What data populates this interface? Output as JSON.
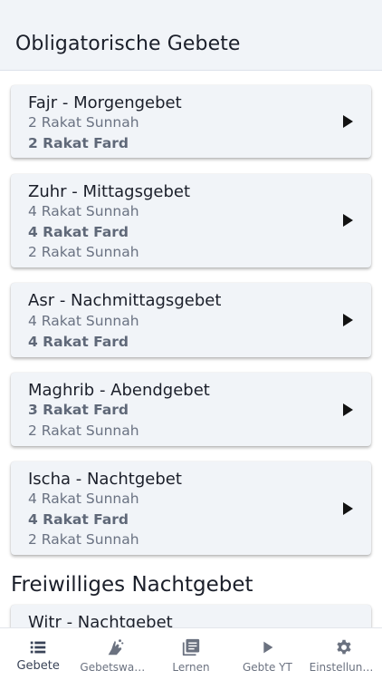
{
  "header": {
    "title": "Obligatorische Gebete"
  },
  "prayers": [
    {
      "name": "Fajr - Morgengebet",
      "lines": [
        {
          "text": "2 Rakat Sunnah",
          "bold": false
        },
        {
          "text": "2 Rakat Fard",
          "bold": true
        }
      ]
    },
    {
      "name": "Zuhr - Mittagsgebet",
      "lines": [
        {
          "text": "4 Rakat Sunnah",
          "bold": false
        },
        {
          "text": "4 Rakat Fard",
          "bold": true
        },
        {
          "text": "2 Rakat Sunnah",
          "bold": false
        }
      ]
    },
    {
      "name": "Asr - Nachmittagsgebet",
      "lines": [
        {
          "text": "4 Rakat Sunnah",
          "bold": false
        },
        {
          "text": "4 Rakat Fard",
          "bold": true
        }
      ]
    },
    {
      "name": "Maghrib - Abendgebet",
      "lines": [
        {
          "text": "3 Rakat Fard",
          "bold": true
        },
        {
          "text": "2 Rakat Sunnah",
          "bold": false
        }
      ]
    },
    {
      "name": "Ischa - Nachtgebet",
      "lines": [
        {
          "text": "4 Rakat Sunnah",
          "bold": false
        },
        {
          "text": "4 Rakat Fard",
          "bold": true
        },
        {
          "text": "2 Rakat Sunnah",
          "bold": false
        }
      ]
    }
  ],
  "voluntary": {
    "title": "Freiwilliges Nachtgebet",
    "items": [
      {
        "name": "Witr - Nachtgebet"
      }
    ]
  },
  "bottom_nav": [
    {
      "label": "Gebete",
      "icon": "list-icon",
      "active": true
    },
    {
      "label": "Gebetswas...",
      "icon": "praying-hands-icon",
      "active": false
    },
    {
      "label": "Lernen",
      "icon": "book-icon",
      "active": false
    },
    {
      "label": "Gebte YT",
      "icon": "play-icon",
      "active": false
    },
    {
      "label": "Einstellung...",
      "icon": "gear-icon",
      "active": false
    }
  ],
  "colors": {
    "header_bg": "#f1f4f8",
    "card_bg": "#f1f4f8",
    "text": "#1b1f2a",
    "muted": "#6a7282"
  }
}
